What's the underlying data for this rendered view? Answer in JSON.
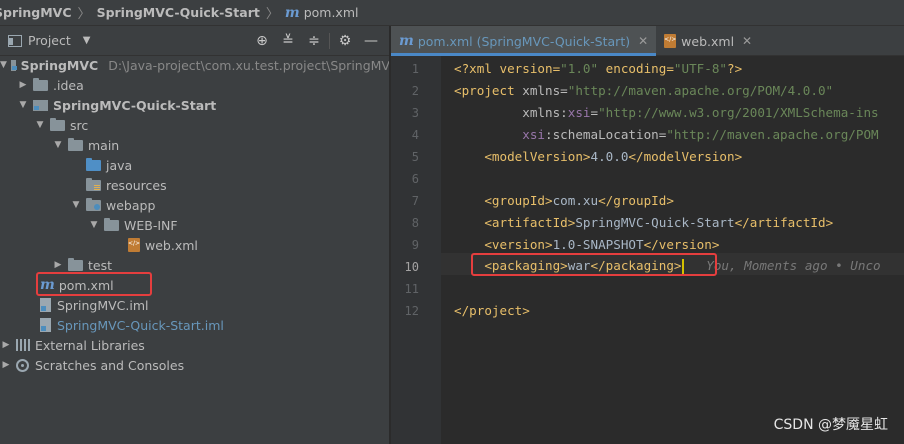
{
  "breadcrumb": {
    "items": [
      "SpringMVC",
      "SpringMVC-Quick-Start",
      "pom.xml"
    ]
  },
  "project_panel": {
    "title": "Project",
    "tools": [
      "target-icon",
      "collapse-all-icon",
      "expand-icon",
      "gear-icon",
      "minimize-icon"
    ],
    "tree": [
      {
        "label": "SpringMVC",
        "hint": "D:\\Java-project\\com.xu.test.project\\SpringMV",
        "icon": "module-folder-icon",
        "bold": true,
        "expanded": true
      },
      {
        "label": ".idea",
        "icon": "folder-icon",
        "expanded": false
      },
      {
        "label": "SpringMVC-Quick-Start",
        "icon": "module-folder-icon",
        "bold": true,
        "expanded": true
      },
      {
        "label": "src",
        "icon": "folder-icon",
        "expanded": true
      },
      {
        "label": "main",
        "icon": "folder-icon",
        "expanded": true
      },
      {
        "label": "java",
        "icon": "source-folder-icon"
      },
      {
        "label": "resources",
        "icon": "resources-folder-icon"
      },
      {
        "label": "webapp",
        "icon": "web-folder-icon",
        "expanded": true
      },
      {
        "label": "WEB-INF",
        "icon": "folder-icon",
        "expanded": true
      },
      {
        "label": "web.xml",
        "icon": "xml-file-icon"
      },
      {
        "label": "test",
        "icon": "folder-icon",
        "expanded": false
      },
      {
        "label": "pom.xml",
        "icon": "maven-file-icon"
      },
      {
        "label": "SpringMVC.iml",
        "icon": "iml-file-icon"
      },
      {
        "label": "SpringMVC-Quick-Start.iml",
        "icon": "iml-file-icon",
        "blue": true
      },
      {
        "label": "External Libraries",
        "icon": "library-icon",
        "expanded": false
      },
      {
        "label": "Scratches and Consoles",
        "icon": "scratches-icon",
        "expanded": false
      }
    ]
  },
  "editor": {
    "tabs": [
      {
        "label": "pom.xml (SpringMVC-Quick-Start)",
        "active": true
      },
      {
        "label": "web.xml",
        "active": false
      }
    ],
    "line_numbers": [
      "1",
      "2",
      "3",
      "4",
      "5",
      "6",
      "7",
      "8",
      "9",
      "10",
      "11",
      "12"
    ],
    "current_line": "10",
    "blame_text": "You, Moments ago • Unco"
  },
  "watermark": "CSDN @梦魇星虹",
  "colors": {
    "highlight_box": "#e53e3e",
    "xml_tag": "#e8bf6a",
    "xml_value": "#6a8759",
    "xml_namespace": "#9876aa"
  }
}
